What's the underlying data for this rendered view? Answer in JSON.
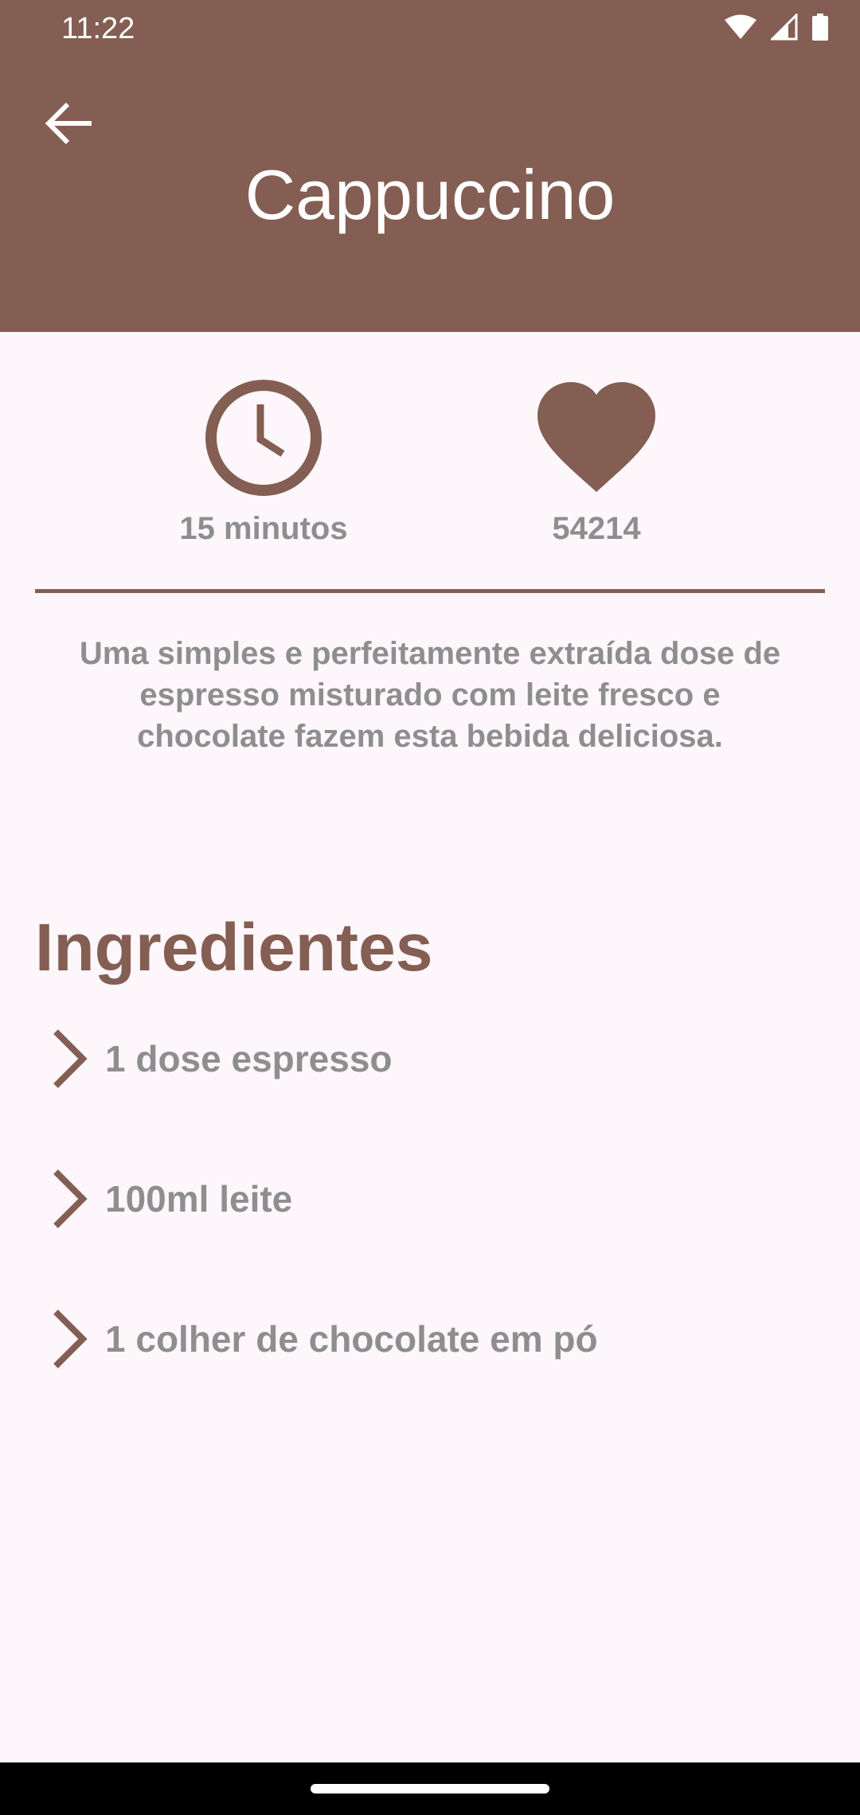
{
  "status_bar": {
    "time": "11:22"
  },
  "header": {
    "title": "Cappuccino"
  },
  "stats": {
    "time_label": "15 minutos",
    "likes_label": "54214"
  },
  "description": "Uma simples e perfeitamente extraída dose de espresso misturado com leite fresco e chocolate fazem esta bebida deliciosa.",
  "ingredients_section": {
    "title": "Ingredientes",
    "items": [
      {
        "label": "1 dose espresso"
      },
      {
        "label": "100ml leite"
      },
      {
        "label": "1 colher de chocolate em pó"
      }
    ]
  },
  "colors": {
    "primary": "#845E53",
    "background": "#FDF7FB",
    "text_muted": "#8E8E8E"
  },
  "icons": {
    "back": "arrow-left-icon",
    "time": "clock-icon",
    "likes": "heart-icon",
    "bullet": "chevron-right-icon"
  }
}
